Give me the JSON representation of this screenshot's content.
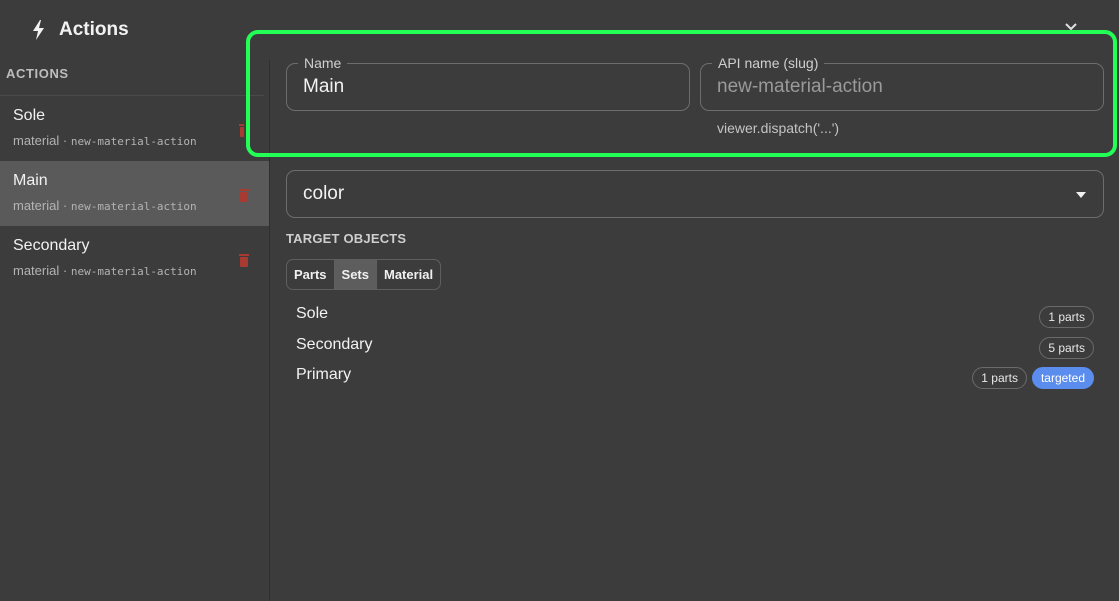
{
  "header": {
    "title": "Actions",
    "icon": "bolt-icon"
  },
  "sidebar": {
    "section_label": "ACTIONS",
    "items": [
      {
        "name": "Sole",
        "type": "material",
        "separator": "·",
        "slug": "new-material-action",
        "active": false
      },
      {
        "name": "Main",
        "type": "material",
        "separator": "·",
        "slug": "new-material-action",
        "active": true
      },
      {
        "name": "Secondary",
        "type": "material",
        "separator": "·",
        "slug": "new-material-action",
        "active": false
      }
    ]
  },
  "form": {
    "name_label": "Name",
    "name_value": "Main",
    "api_label": "API name (slug)",
    "api_placeholder": "new-material-action",
    "hint": "viewer.dispatch('...')",
    "property_value": "color"
  },
  "targets": {
    "label": "TARGET OBJECTS",
    "tabs": [
      "Parts",
      "Sets",
      "Material"
    ],
    "active_tab": "Sets",
    "rows": [
      {
        "name": "Sole",
        "badge": "1 parts",
        "targeted": ""
      },
      {
        "name": "Secondary",
        "badge": "5 parts",
        "targeted": ""
      },
      {
        "name": "Primary",
        "badge": "1 parts",
        "targeted": "targeted"
      }
    ]
  },
  "colors": {
    "highlight": "#22ff55",
    "accent": "#5b8def",
    "trash": "#c0392b"
  }
}
